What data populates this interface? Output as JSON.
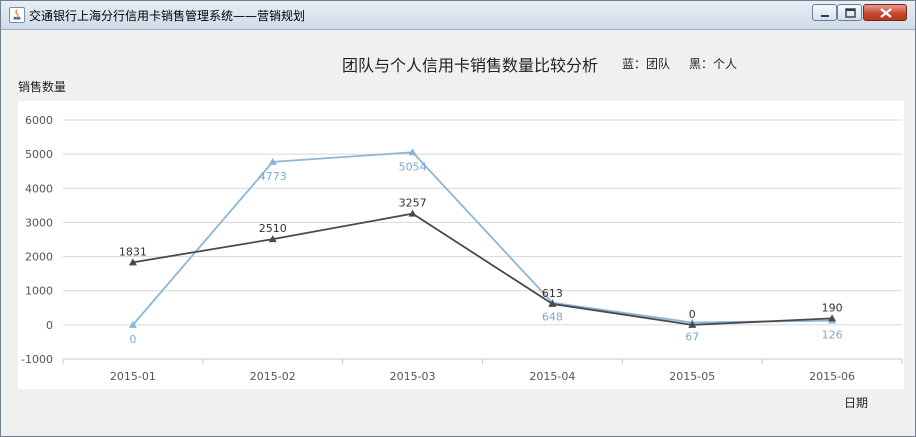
{
  "window": {
    "title": "交通银行上海分行信用卡销售管理系统——营销规划",
    "controls": {
      "minimize": "minimize-icon",
      "maximize": "maximize-icon",
      "close": "close-icon"
    }
  },
  "chart_header": {
    "title": "团队与个人信用卡销售数量比较分析",
    "legend_blue": "蓝：团队",
    "legend_black": "黑：个人"
  },
  "axis_labels": {
    "y": "销售数量",
    "x": "日期"
  },
  "colors": {
    "team": "#8cb6d8",
    "individual": "#4a4a4a",
    "grid": "#d8d8d8",
    "tick_text": "#555555"
  },
  "chart_data": {
    "type": "line",
    "title": "团队与个人信用卡销售数量比较分析",
    "xlabel": "日期",
    "ylabel": "销售数量",
    "categories": [
      "2015-01",
      "2015-02",
      "2015-03",
      "2015-04",
      "2015-05",
      "2015-06"
    ],
    "ylim": [
      -1000,
      6000
    ],
    "yticks": [
      -1000,
      0,
      1000,
      2000,
      3000,
      4000,
      5000,
      6000
    ],
    "grid": true,
    "series": [
      {
        "name": "团队",
        "color": "#8cb6d8",
        "marker": "triangle",
        "label_position": "below",
        "values": [
          0,
          4773,
          5054,
          648,
          67,
          126
        ]
      },
      {
        "name": "个人",
        "color": "#4a4a4a",
        "marker": "triangle",
        "label_position": "above",
        "values": [
          1831,
          2510,
          3257,
          613,
          0,
          190
        ]
      }
    ]
  }
}
